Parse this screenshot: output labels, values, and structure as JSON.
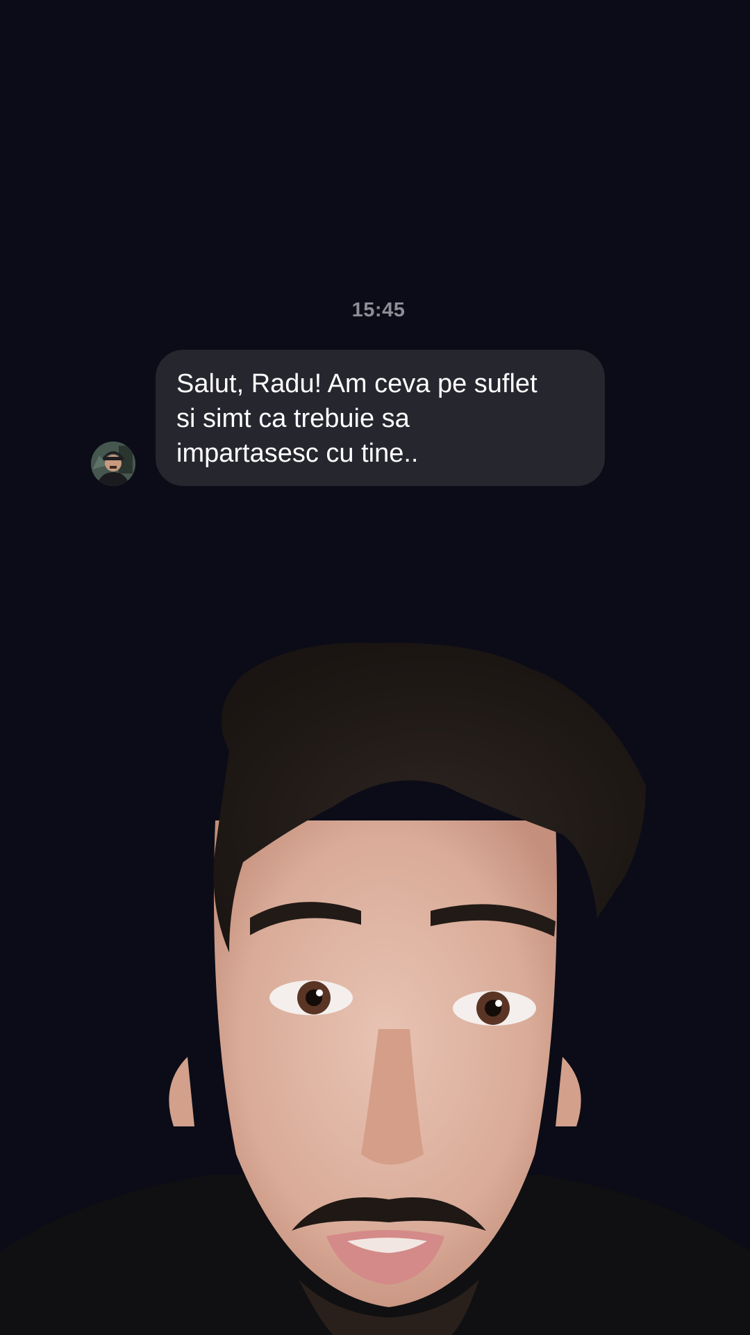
{
  "chat": {
    "timestamp": "15:45",
    "message": {
      "text": "Salut, Radu! Am ceva pe suflet\nsi simt ca trebuie sa\nimpartasesc cu tine.."
    }
  },
  "icons": {
    "avatar": "sender-avatar-photo",
    "person": "speaker-video-overlay"
  },
  "colors": {
    "background": "#0b0c17",
    "bubble": "#26262e",
    "timestamp": "#8e8e96",
    "message_text": "#ffffff"
  }
}
